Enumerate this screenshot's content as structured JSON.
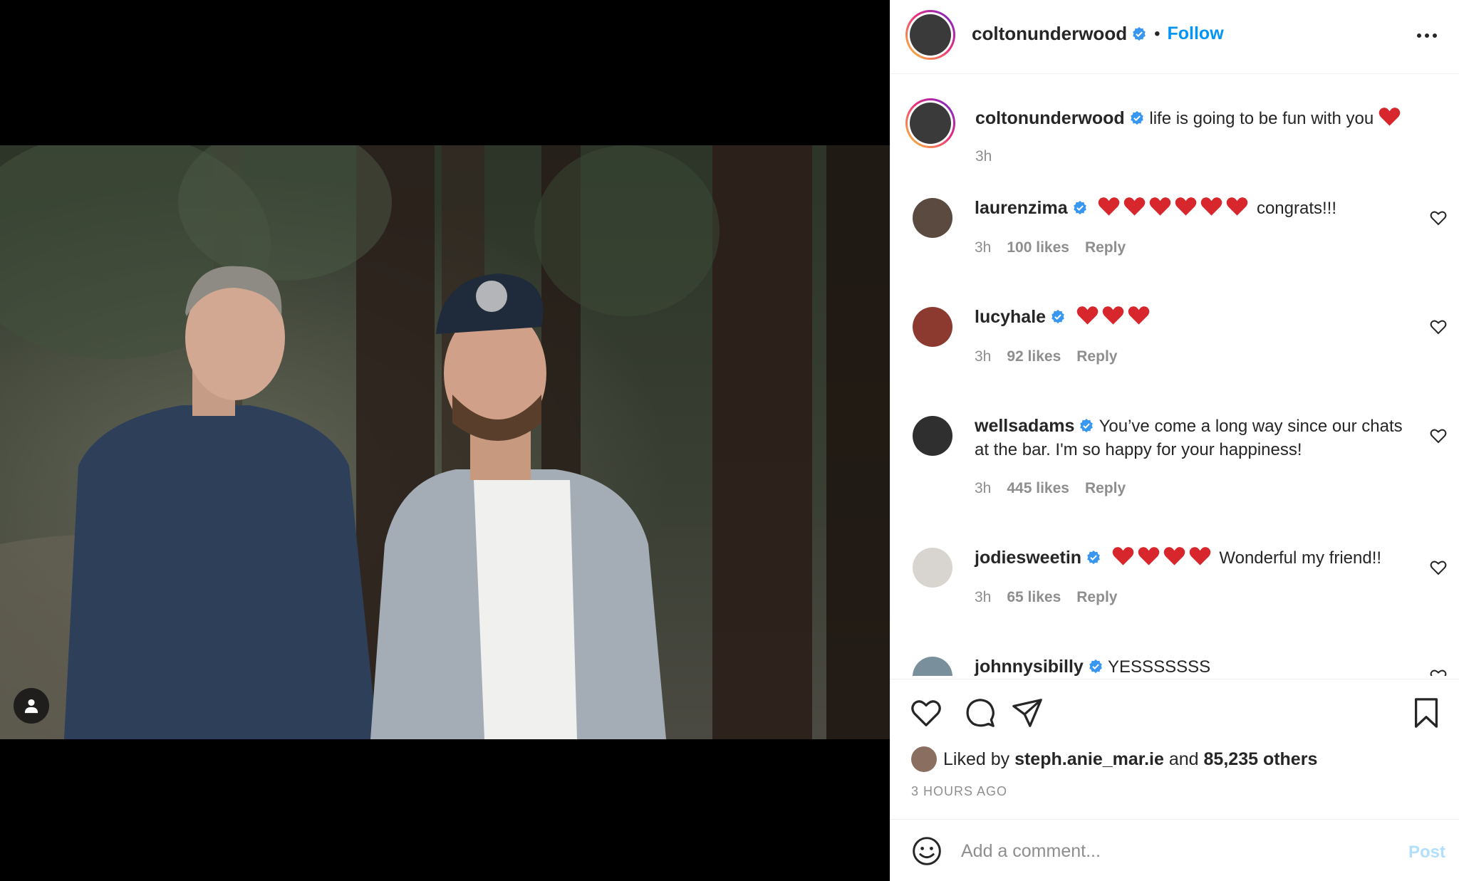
{
  "post": {
    "author": "coltonunderwood",
    "follow_label": "Follow",
    "separator": "•"
  },
  "caption": {
    "username": "coltonunderwood",
    "text": "life is going to be fun with you",
    "time": "3h"
  },
  "comments": [
    {
      "username": "laurenzima",
      "hearts": 6,
      "text": "congrats!!!",
      "time": "3h",
      "likes": "100 likes",
      "reply": "Reply"
    },
    {
      "username": "lucyhale",
      "hearts": 3,
      "text": "",
      "time": "3h",
      "likes": "92 likes",
      "reply": "Reply"
    },
    {
      "username": "wellsadams",
      "hearts": 0,
      "text": "You’ve come a long way since our chats at the bar. I'm so happy for your happiness!",
      "time": "3h",
      "likes": "445 likes",
      "reply": "Reply"
    },
    {
      "username": "jodiesweetin",
      "hearts": 4,
      "text": "Wonderful my friend!!",
      "time": "3h",
      "likes": "65 likes",
      "reply": "Reply"
    },
    {
      "username": "johnnysibilly",
      "hearts": 0,
      "text": "YESSSSSSS",
      "time": "",
      "likes": "",
      "reply": ""
    }
  ],
  "likes_bar": {
    "prefix": "Liked by",
    "user": "steph.anie_mar.ie",
    "conj": "and",
    "others": "85,235 others"
  },
  "timestamp": "3 HOURS AGO",
  "comment_box": {
    "placeholder": "Add a comment...",
    "post_label": "Post"
  },
  "colors": {
    "link": "#0095f6",
    "verified": "#3897f0",
    "heart": "#ed4956",
    "post_disabled": "#b2dffc"
  },
  "icons": [
    "more-icon",
    "verified-icon",
    "heart-icon",
    "comment-icon",
    "share-icon",
    "bookmark-icon",
    "emoji-icon",
    "user-tag-icon"
  ]
}
